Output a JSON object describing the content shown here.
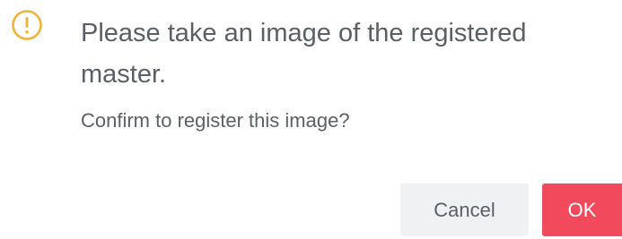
{
  "dialog": {
    "icon": "warning-circle-icon",
    "icon_color": "#f3b23a",
    "title": "Please take an image of the registered master.",
    "message": "Confirm to register this image?",
    "buttons": {
      "cancel_label": "Cancel",
      "ok_label": "OK"
    },
    "colors": {
      "ok_background": "#f24a5d",
      "cancel_background": "#eff1f3",
      "text": "#5b6068"
    }
  }
}
